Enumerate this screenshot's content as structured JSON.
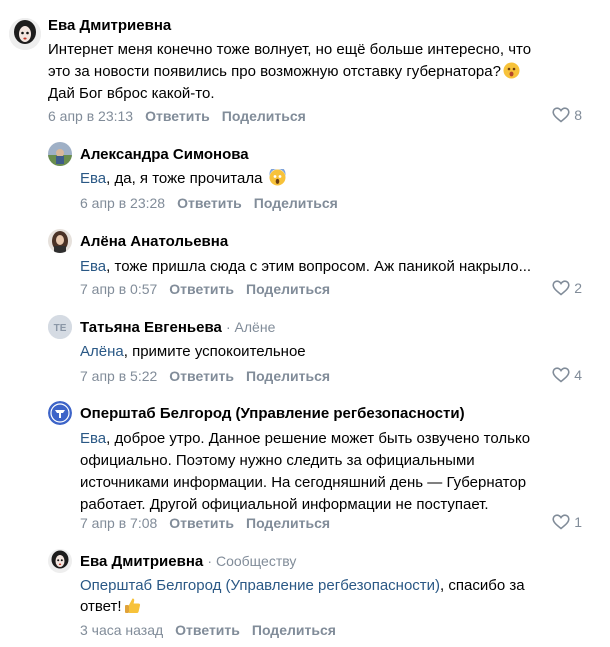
{
  "comments": [
    {
      "author": "Ева Дмитриевна",
      "lines": [
        "Интернет меня конечно тоже волнует, но ещё больше интересно, что",
        "это за новости появились про возможную отставку губернатора?",
        "Дай Бог вброс какой-то."
      ],
      "date": "6 апр в 23:13",
      "reply": "Ответить",
      "share": "Поделиться",
      "likes": "8"
    },
    {
      "author": "Александра Симонова",
      "mention": "Ева",
      "text": ", да, я тоже прочитала",
      "date": "6 апр в 23:28",
      "reply": "Ответить",
      "share": "Поделиться"
    },
    {
      "author": "Алёна Анатольевна",
      "mention": "Ева",
      "text": ", тоже пришла сюда с этим вопросом. Аж паникой накрыло...",
      "date": "7 апр в 0:57",
      "reply": "Ответить",
      "share": "Поделиться",
      "likes": "2"
    },
    {
      "author": "Татьяна Евгеньева",
      "reply_to": "· Алёне",
      "mention": "Алёна",
      "text": ", примите успокоительное",
      "date": "7 апр в 5:22",
      "reply": "Ответить",
      "share": "Поделиться",
      "likes": "4"
    },
    {
      "author": "Оперштаб Белгород (Управление регбезопасности)",
      "mention": "Ева",
      "line1_rest": ", доброе утро. Данное решение может быть озвучено только",
      "lines": [
        "официально. Поэтому нужно следить за официальными",
        "источниками информации. На сегодняшний день — Губернатор",
        "работает. Другой официальной информации не поступает."
      ],
      "date": "7 апр в 7:08",
      "reply": "Ответить",
      "share": "Поделиться",
      "likes": "1"
    },
    {
      "author": "Ева Дмитриевна",
      "reply_to": "· Сообществу",
      "mention": "Оперштаб Белгород (Управление регбезопасности)",
      "line1_rest": ", спасибо за",
      "line2": "ответ!",
      "date": "3 часа назад",
      "reply": "Ответить",
      "share": "Поделиться"
    }
  ],
  "icons": {
    "like": "heart-outline-icon",
    "emoji_shocked": "astonished-face-emoji",
    "emoji_screaming": "face-screaming-in-fear-emoji",
    "emoji_thumbs": "thumbs-up-emoji"
  },
  "colors": {
    "mention": "#2a5885",
    "meta": "#818c99",
    "text": "#000000"
  }
}
